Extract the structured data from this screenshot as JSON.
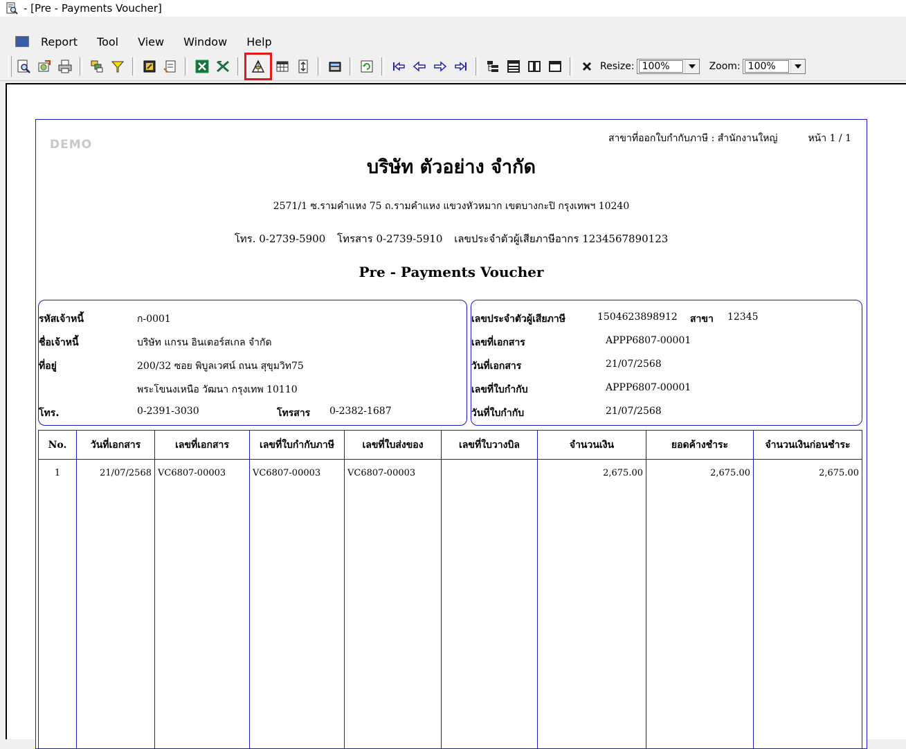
{
  "window": {
    "title": "- [Pre - Payments Voucher]"
  },
  "menu": {
    "items": [
      "Report",
      "Tool",
      "View",
      "Window",
      "Help"
    ]
  },
  "toolbar": {
    "buttons": [
      {
        "icon": "preview-icon"
      },
      {
        "icon": "export-icon"
      },
      {
        "icon": "print-icon"
      },
      {
        "icon": "group-icon"
      },
      {
        "icon": "filter-icon"
      },
      {
        "icon": "design-icon"
      },
      {
        "icon": "page-setup-icon"
      },
      {
        "icon": "excel-icon"
      },
      {
        "icon": "excel-export-icon"
      },
      {
        "icon": "pen-design-icon"
      },
      {
        "icon": "grid-icon"
      },
      {
        "icon": "fit-height-icon"
      },
      {
        "icon": "calculator-icon"
      },
      {
        "icon": "refresh-icon"
      },
      {
        "icon": "first-page-icon"
      },
      {
        "icon": "prev-page-icon"
      },
      {
        "icon": "next-page-icon"
      },
      {
        "icon": "last-page-icon"
      },
      {
        "icon": "tree-icon"
      },
      {
        "icon": "rows-icon"
      },
      {
        "icon": "columns-icon"
      },
      {
        "icon": "window-icon"
      },
      {
        "icon": "close-icon"
      }
    ],
    "resize_label": "Resize:",
    "resize_value": "100%",
    "zoom_label": "Zoom:",
    "zoom_value": "100%"
  },
  "report": {
    "demo_watermark": "DEMO",
    "branch_line": "สาขาที่ออกใบกำกับภาษี : สำนักงานใหญ่",
    "page_no": "หน้า 1 / 1",
    "company": "บริษัท ตัวอย่าง จำกัด",
    "address": "2571/1 ซ.รามคำแหง 75 ถ.รามคำแหง แขวงหัวหมาก เขตบางกะปิ กรุงเทพฯ 10240",
    "phone": "โทร. 0-2739-5900",
    "fax": "โทรสาร 0-2739-5910",
    "tax_id_line": "เลขประจำตัวผู้เสียภาษีอากร 1234567890123",
    "doc_title": "Pre - Payments Voucher",
    "creditor": {
      "code_label": "รหัสเจ้าหนี้",
      "code": "ก-0001",
      "name_label": "ชื่อเจ้าหนี้",
      "name": "บริษัท แกรน อินเตอร์สเกล จำกัด",
      "addr_label": "ที่อยู่",
      "addr1": "200/32 ซอย พิบูลเวศน์ ถนน สุขุมวิท75",
      "addr2": "พระโขนงเหนือ วัฒนา กรุงเทพ 10110",
      "tel_label": "โทร.",
      "tel": "0-2391-3030",
      "fax_label": "โทรสาร",
      "fax": "0-2382-1687"
    },
    "tax": {
      "taxid_label": "เลขประจำตัวผู้เสียภาษี",
      "taxid": "1504623898912",
      "branch_label": "สาขา",
      "branch": "12345",
      "docno_label": "เลขที่เอกสาร",
      "docno": "APPP6807-00001",
      "docdate_label": "วันที่เอกสาร",
      "docdate": "21/07/2568",
      "invno_label": "เลขที่ใบกำกับ",
      "invno": "APPP6807-00001",
      "invdate_label": "วันที่ใบกำกับ",
      "invdate": "21/07/2568"
    },
    "table": {
      "headers": [
        "No.",
        "วันที่เอกสาร",
        "เลขที่เอกสาร",
        "เลขที่ใบกำกับภาษี",
        "เลขที่ใบส่งของ",
        "เลขที่ใบวางบิล",
        "จำนวนเงิน",
        "ยอดค้างชำระ",
        "จำนวนเงินก่อนชำระ"
      ],
      "rows": [
        [
          "1",
          "21/07/2568",
          "VC6807-00003",
          "VC6807-00003",
          "VC6807-00003",
          "",
          "2,675.00",
          "2,675.00",
          "2,675.00"
        ]
      ]
    }
  }
}
